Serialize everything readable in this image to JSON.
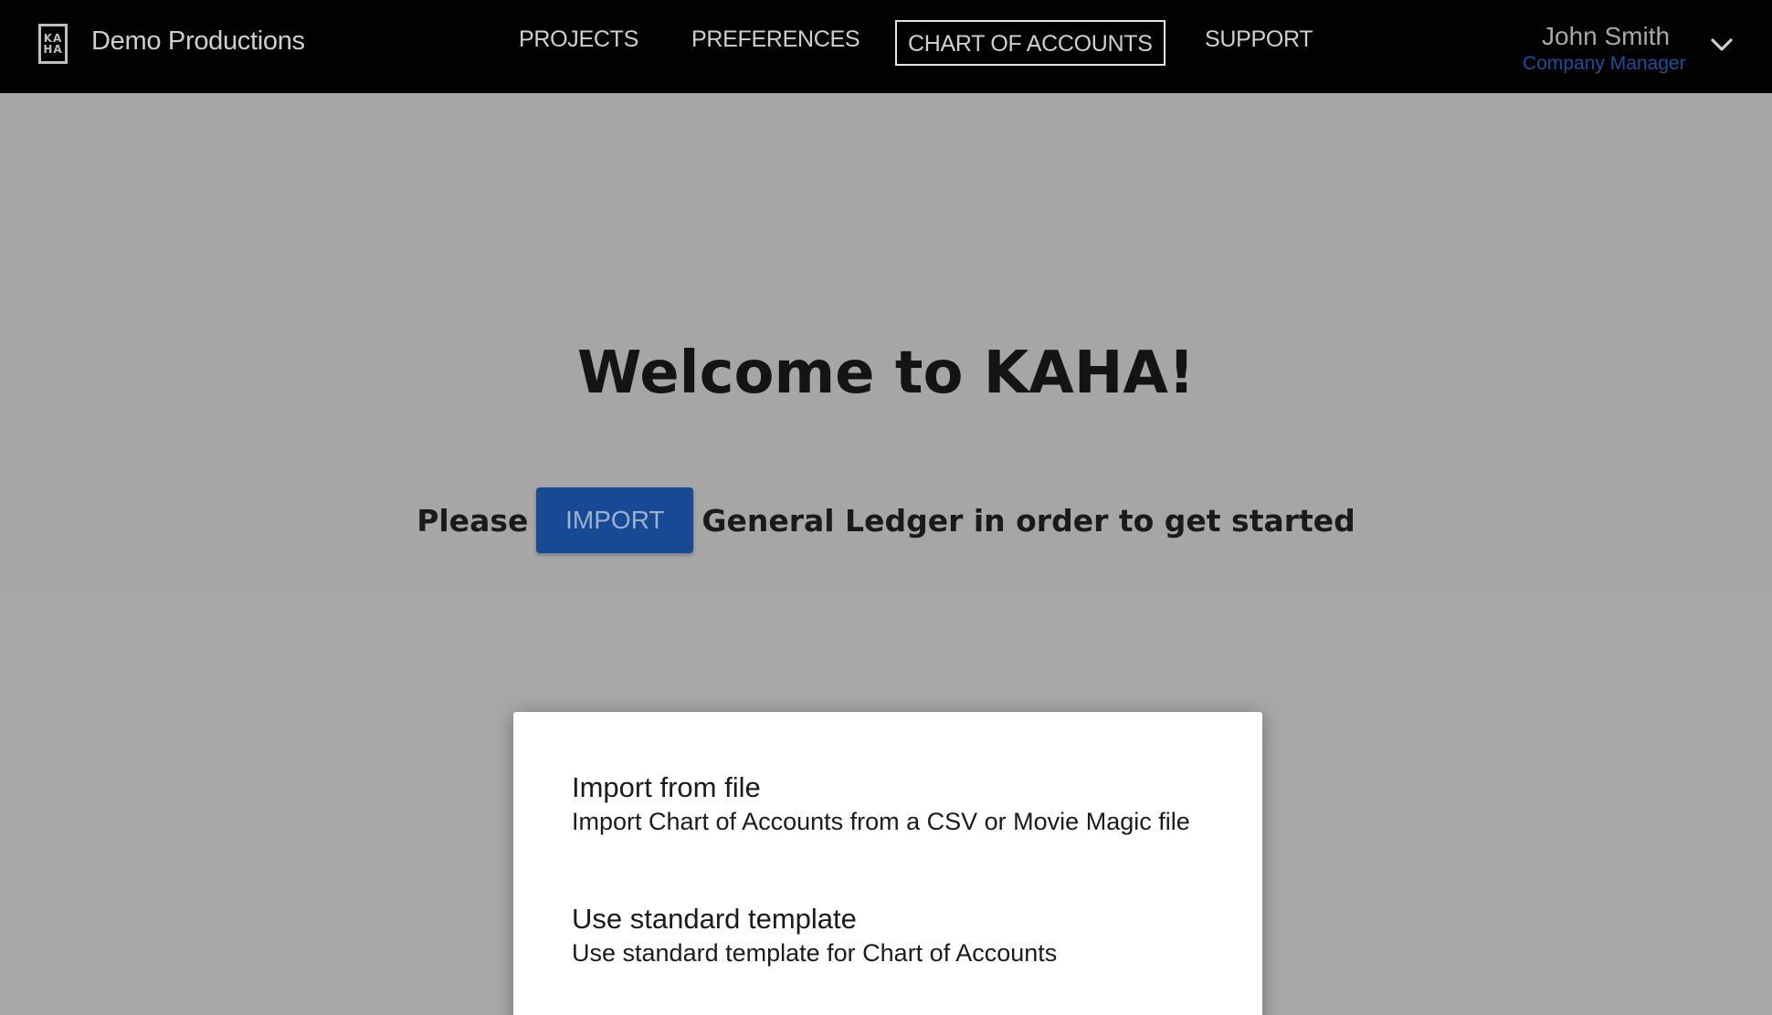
{
  "header": {
    "logo_lines": [
      "KA",
      "HA"
    ],
    "brand": "Demo Productions",
    "nav": [
      "PROJECTS",
      "PREFERENCES",
      "CHART OF ACCOUNTS",
      "SUPPORT"
    ],
    "active_nav": "CHART OF ACCOUNTS",
    "user": {
      "name": "John Smith",
      "role": "Company Manager"
    }
  },
  "hero": {
    "welcome": "Welcome to KAHA!",
    "prefix": "Please",
    "import_button": "IMPORT",
    "suffix": "General Ledger in order to get started"
  },
  "import_menu": {
    "options": [
      {
        "title": "Import from file",
        "description": "Import Chart of Accounts from a CSV or Movie Magic file"
      },
      {
        "title": "Use standard template",
        "description": "Use standard template for Chart of Accounts"
      }
    ]
  },
  "colors": {
    "header_bg": "#020202",
    "accent": "#174a94",
    "role_text": "#1e4f9c",
    "overlay": "#a8a8a8"
  },
  "icons": [
    "logo-icon",
    "chevron-down-icon"
  ]
}
